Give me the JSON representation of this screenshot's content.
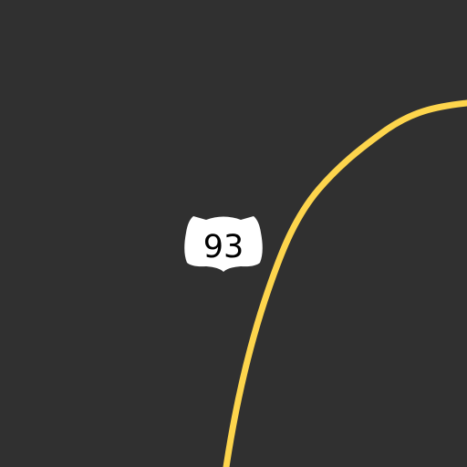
{
  "map": {
    "background_color": "#303030",
    "road": {
      "color": "#FDD54C",
      "type": "highway"
    },
    "shield": {
      "type": "us-highway-shield",
      "route_number": "93",
      "fill_color": "#FFFFFF",
      "text_color": "#000000"
    }
  }
}
